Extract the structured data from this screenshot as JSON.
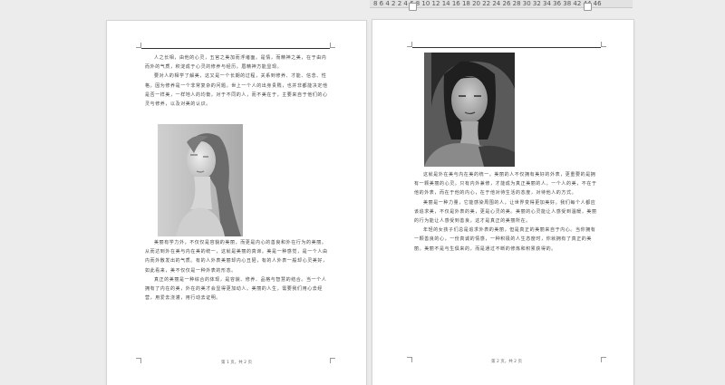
{
  "ruler": {
    "ticks": "8  6  4  2      2  4  6  8  10 12 14 16 18 20 22 24 26 28 30 32 34 36 38      42 44 46"
  },
  "page1": {
    "paragraphs": [
      "人之长相，由他的心灵，五官之美加而浮诸面。是情，而精神之美，在于由内而外的气质，积淀成于心灵的修养与经历。眉精神方能显现。",
      "要对人的相学了解美，这又是一个长期的过程，关系到修养、才能、信念、性格，因为修养是一个非常复杂的问题。世上一个人的出身贵贱，也并非都能决定他是否一样美，一样地人的均衡。对于不同的人，而不美在于，主要来自于他们的心灵与修养，以及对美的认识。"
    ],
    "paragraphs2": [
      "美丽有学力外，不仅仅是容貌的美丽，而更是内心的善良和外在行为的美丽。从而达到外在美与内在美的统一，这就是美丽的真谛。美是一种感觉，是一个人由内而外散发出的气质。有的人外表美丽却内心丑陋，有的人外表一般却心灵美好，如此看来，美不仅仅是一种外表的形态。",
      "真正的美丽是一种综合的体现，是容貌、修养、品格与智慧的结合。当一个人拥有了内在的美，外在的美才会显得更加动人。美丽的人生，需要我们用心去经营，用爱去浇灌，用行动去证明。"
    ],
    "footer": "第 1 页，共 2 页"
  },
  "page2": {
    "paragraphs": [
      "这就是外在美与内在美的统一。美丽的人不仅拥有美好的外表，更重要的是拥有一颗美丽的心灵。只有内外兼修，才能成为真正美丽的人。一个人的美，不在于他的外表，而在于他的内心，在于他对待生活的态度，对待他人的方式。",
      "美丽是一种力量，它能感染周围的人，让世界变得更加美好。我们每个人都应该追求美，不仅是外表的美，更是心灵的美。美丽的心灵能让人感受到温暖，美丽的行为能让人感受到善良，这才是真正的美丽所在。",
      "年轻的女孩子们总是追求外表的美丽，但是真正的美丽来自于内心。当你拥有一颗善良的心，一份真诚的情感，一种积极的人生态度时，你就拥有了真正的美丽。美丽不是与生俱来的，而是通过不断的修炼和积累获得的。"
    ],
    "footer": "第 2 页，共 2 页"
  }
}
